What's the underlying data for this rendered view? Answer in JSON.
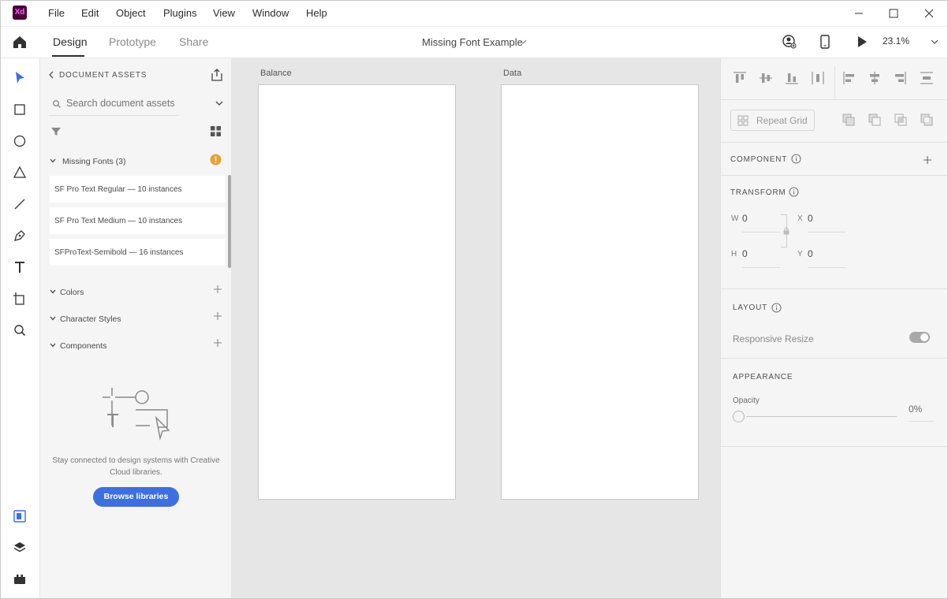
{
  "app": {
    "icon_label": "Xd"
  },
  "menu": [
    "File",
    "Edit",
    "Object",
    "Plugins",
    "View",
    "Window",
    "Help"
  ],
  "toolbar": {
    "tabs": [
      "Design",
      "Prototype",
      "Share"
    ],
    "active_tab": "Design",
    "document_title": "Missing Font Example",
    "zoom": "23.1%"
  },
  "assets": {
    "header": "DOCUMENT ASSETS",
    "search_placeholder": "Search document assets",
    "missing_fonts": {
      "label": "Missing Fonts (3)",
      "items": [
        "SF Pro Text Regular — 10 instances",
        "SF Pro Text Medium — 10 instances",
        "SFProText-Semibold — 16 instances"
      ]
    },
    "sections": [
      "Colors",
      "Character Styles",
      "Components"
    ],
    "empty_text": "Stay connected to design systems with Creative Cloud libraries.",
    "browse_button": "Browse libraries"
  },
  "canvas": {
    "artboards": [
      "Balance",
      "Data"
    ]
  },
  "properties": {
    "repeat_grid": "Repeat Grid",
    "component_header": "COMPONENT",
    "transform_header": "TRANSFORM",
    "fields": {
      "w_label": "W",
      "w": "0",
      "x_label": "X",
      "x": "0",
      "h_label": "H",
      "h": "0",
      "y_label": "Y",
      "y": "0"
    },
    "layout_header": "LAYOUT",
    "responsive_resize": "Responsive Resize",
    "responsive_resize_on": true,
    "appearance_header": "APPEARANCE",
    "opacity_label": "Opacity",
    "opacity_value": "0%"
  },
  "colors": {
    "accent": "#3d6fe0",
    "warning": "#e6a23c",
    "xd_brand": "#470137"
  }
}
